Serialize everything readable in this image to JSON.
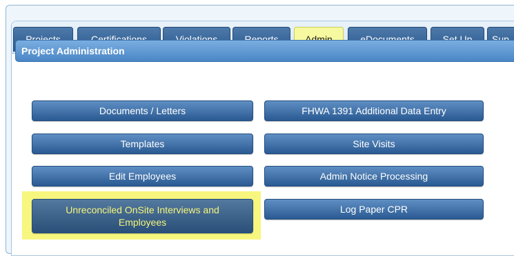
{
  "tabs": [
    {
      "label": "Projects",
      "active": false
    },
    {
      "label": "Certifications",
      "active": false
    },
    {
      "label": "Violations",
      "active": false
    },
    {
      "label": "Reports",
      "active": false
    },
    {
      "label": "Admin",
      "active": true
    },
    {
      "label": "eDocuments",
      "active": false
    },
    {
      "label": "Set Up",
      "active": false
    },
    {
      "label": "Sup",
      "active": false
    }
  ],
  "section": {
    "title": "Project Administration"
  },
  "buttons": {
    "documents_letters": "Documents / Letters",
    "fhwa_1391": "FHWA 1391 Additional Data Entry",
    "templates": "Templates",
    "site_visits": "Site Visits",
    "edit_employees": "Edit Employees",
    "admin_notice": "Admin Notice Processing",
    "unreconciled": "Unreconciled OnSite Interviews and Employees",
    "log_paper_cpr": "Log Paper CPR"
  },
  "colors": {
    "active_tab": "#f7f9a0",
    "highlight": "#f7f67e",
    "button_blue": "#2a5a92"
  }
}
